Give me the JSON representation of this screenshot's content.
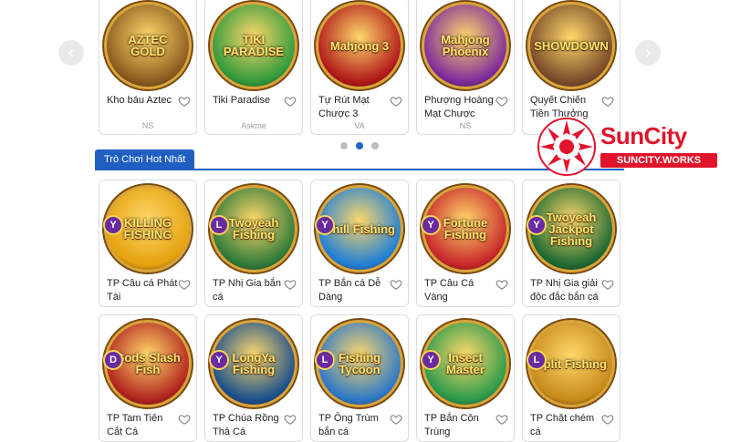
{
  "carousel": {
    "prev_label": "‹",
    "next_label": "›",
    "games": [
      {
        "name": "Kho báu Aztec",
        "provider": "NS",
        "thumb_text": "AZTEC GOLD",
        "color": "#8a5a1e"
      },
      {
        "name": "Tiki Paradise",
        "provider": "Askme",
        "thumb_text": "TIKI PARADISE",
        "color": "#2f9a3b"
      },
      {
        "name": "Tự Rút Mạt Chược 3",
        "provider": "VA",
        "thumb_text": "Mahjong 3",
        "color": "#b01818"
      },
      {
        "name": "Phượng Hoàng Mạt Chược",
        "provider": "NS",
        "thumb_text": "Mahjong Phoenix",
        "color": "#7d2a9c"
      },
      {
        "name": "Quyết Chiến Tiền Thưởng",
        "provider": "",
        "thumb_text": "SHOWDOWN",
        "color": "#7a4a2a"
      }
    ],
    "page_count": 3,
    "active_page": 1
  },
  "section": {
    "tab_label": "Trò Chơi Hot Nhất"
  },
  "hot_games_row1": [
    {
      "name": "TP Câu cá Phát Tài",
      "badge": "Y",
      "thumb_text": "KILLING FISHING",
      "color": "#e4a20e"
    },
    {
      "name": "TP Nhị Gia bắn cá",
      "badge": "L",
      "thumb_text": "Twoyeah Fishing",
      "color": "#2f7a3a"
    },
    {
      "name": "TP Bắn cá Dễ Dàng",
      "badge": "Y",
      "thumb_text": "Chill Fishing",
      "color": "#1f7fd6"
    },
    {
      "name": "TP Câu Cá Vàng",
      "badge": "Y",
      "thumb_text": "Fortune Fishing",
      "color": "#c8262a"
    },
    {
      "name": "TP Nhị Gia giải độc đắc bắn cá",
      "badge": "Y",
      "thumb_text": "Twoyeah Jackpot Fishing",
      "color": "#1d6a33"
    }
  ],
  "hot_games_row2": [
    {
      "name": "TP Tam Tiên Cắt Cá",
      "badge": "D",
      "thumb_text": "Gods Slash Fish",
      "color": "#b1231e"
    },
    {
      "name": "TP Chúa Rồng Thả Cá",
      "badge": "Y",
      "thumb_text": "LongYa Fishing",
      "color": "#1a4f8c"
    },
    {
      "name": "TP Ông Trùm bắn cá",
      "badge": "L",
      "thumb_text": "Fishing Tycoon",
      "color": "#2c78c8"
    },
    {
      "name": "TP Bắn Côn Trùng",
      "badge": "Y",
      "thumb_text": "Insect Master",
      "color": "#2a9a4a"
    },
    {
      "name": "TP Chặt chém cá",
      "badge": "L",
      "thumb_text": "Split Fishing",
      "color": "#c68a1a"
    }
  ],
  "brand": {
    "name": "SunCity",
    "sub": "SUNCITY.WORKS",
    "color": "#e0142a"
  },
  "colors": {
    "accent": "#1f5fc1",
    "heart": "#888888"
  },
  "icons": {
    "heart": "heart-icon",
    "prev": "chevron-left-icon",
    "next": "chevron-right-icon",
    "logo": "suncity-logo-icon"
  }
}
